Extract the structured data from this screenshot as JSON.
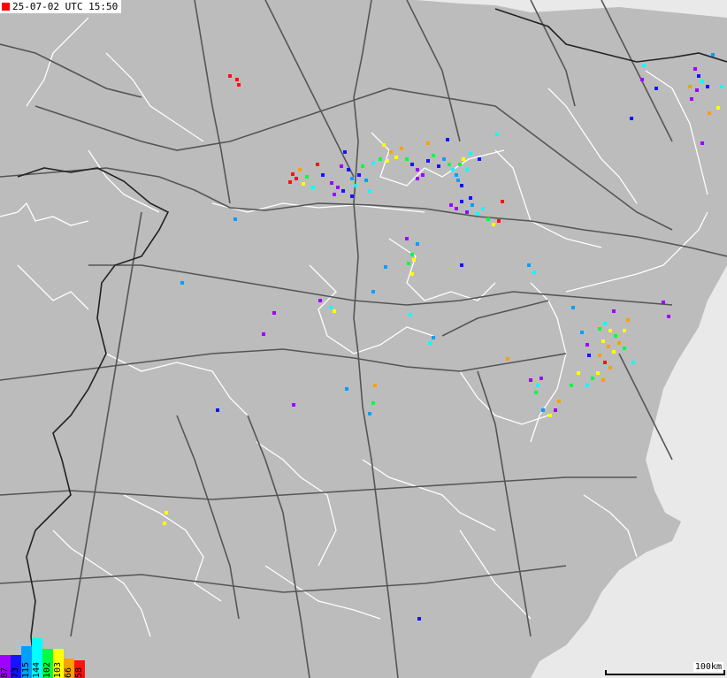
{
  "timestamp": "25-07-02 UTC 15:50",
  "legend": {
    "entries": [
      {
        "label": "87",
        "color": "#a000ff"
      },
      {
        "label": "73",
        "color": "#1414ff"
      },
      {
        "label": "115",
        "color": "#00a0ff"
      },
      {
        "label": "144",
        "color": "#00ffff"
      },
      {
        "label": "102",
        "color": "#00ff40"
      },
      {
        "label": "103",
        "color": "#ffff00"
      },
      {
        "label": "66",
        "color": "#ff9f00"
      },
      {
        "label": "58",
        "color": "#ff1010"
      }
    ]
  },
  "scale": {
    "label": "100km"
  },
  "colors": {
    "land": "#bcbcbc",
    "sea": "#e9e9e9",
    "roads": "#555555",
    "borders": "#ffffff",
    "national_border": "#222222"
  }
}
